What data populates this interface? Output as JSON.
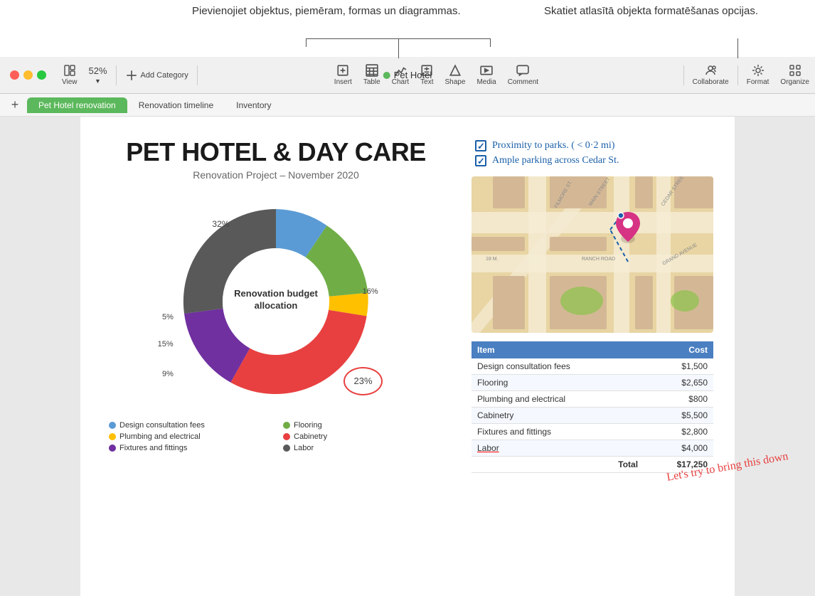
{
  "annotations": {
    "left": "Pievienojiet objektus, piemēram,\nformas un diagrammas.",
    "right": "Skatiet atlasītā objekta\nformatēšanas opcijas."
  },
  "titlebar": {
    "title": "Pet Hotel",
    "zoom": "52%"
  },
  "toolbar": {
    "view_label": "View",
    "zoom_label": "52%",
    "add_category_label": "Add Category",
    "insert_label": "Insert",
    "table_label": "Table",
    "chart_label": "Chart",
    "text_label": "Text",
    "shape_label": "Shape",
    "media_label": "Media",
    "comment_label": "Comment",
    "collaborate_label": "Collaborate",
    "format_label": "Format",
    "organize_label": "Organize"
  },
  "tabs": {
    "add_label": "+",
    "active": "Pet Hotel renovation",
    "items": [
      {
        "label": "Pet Hotel renovation",
        "active": true
      },
      {
        "label": "Renovation timeline",
        "active": false
      },
      {
        "label": "Inventory",
        "active": false
      }
    ]
  },
  "page": {
    "title": "PET HOTEL & DAY CARE",
    "subtitle": "Renovation Project – November 2020"
  },
  "chart": {
    "center_label": "Renovation budget\nallocation",
    "segments": [
      {
        "label": "Design consultation fees",
        "color": "#5b9bd5",
        "pct": 9,
        "startAngle": 0
      },
      {
        "label": "Flooring",
        "color": "#70ad47",
        "pct": 15,
        "startAngle": 32
      },
      {
        "label": "Plumbing and electrical",
        "color": "#ffc000",
        "pct": 5,
        "startAngle": 86
      },
      {
        "label": "Cabinetry",
        "color": "#ff0000",
        "pct": 32,
        "startAngle": 104
      },
      {
        "label": "Fixtures and fittings",
        "color": "#7030a0",
        "pct": 16,
        "startAngle": 219
      },
      {
        "label": "Labor",
        "color": "#595959",
        "pct": 23,
        "startAngle": 276
      }
    ],
    "pct_labels": [
      {
        "text": "32%",
        "top": "18%",
        "left": "26%"
      },
      {
        "text": "16%",
        "top": "45%",
        "left": "90%"
      },
      {
        "text": "5%",
        "top": "56%",
        "left": "4%"
      },
      {
        "text": "15%",
        "top": "72%",
        "left": "4%"
      },
      {
        "text": "9%",
        "top": "82%",
        "left": "8%"
      },
      {
        "text": "23%",
        "top": "76%",
        "left": "75%"
      }
    ]
  },
  "legend": [
    {
      "label": "Design consultation fees",
      "color": "#5b9bd5"
    },
    {
      "label": "Flooring",
      "color": "#70ad47"
    },
    {
      "label": "Plumbing and electrical",
      "color": "#ffc000"
    },
    {
      "label": "Cabinetry",
      "color": "#ff0000"
    },
    {
      "label": "Fixtures and fittings",
      "color": "#7030a0"
    },
    {
      "label": "Labor",
      "color": "#595959"
    }
  ],
  "checklist": [
    {
      "text": "Proximity to parks. ( < 0·2 mi)",
      "checked": true
    },
    {
      "text": "Ample parking across  Cedar St.",
      "checked": true
    }
  ],
  "table": {
    "headers": [
      "Item",
      "Cost"
    ],
    "rows": [
      {
        "item": "Design consultation fees",
        "cost": "$1,500"
      },
      {
        "item": "Flooring",
        "cost": "$2,650"
      },
      {
        "item": "Plumbing and electrical",
        "cost": "$800"
      },
      {
        "item": "Cabinetry",
        "cost": "$5,500"
      },
      {
        "item": "Fixtures and fittings",
        "cost": "$2,800"
      },
      {
        "item": "Labor",
        "cost": "$4,000",
        "underline": true
      }
    ],
    "total_label": "Total",
    "total_value": "$17,250"
  },
  "handwriting": {
    "text": "Let's try\nto bring\nthis down"
  }
}
